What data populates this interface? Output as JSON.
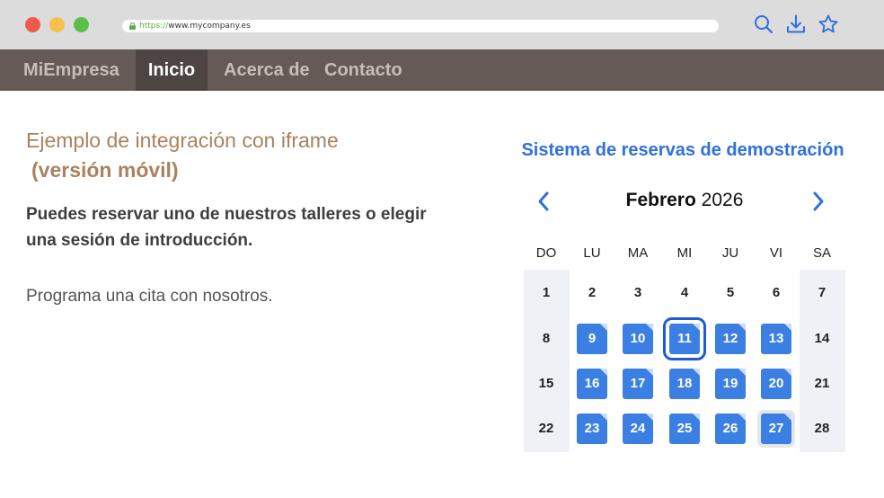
{
  "browser": {
    "url_protocol": "https://",
    "url_host": "www.mycompany.es",
    "icons": [
      "search-icon",
      "download-icon",
      "star-icon"
    ]
  },
  "nav": {
    "brand": "MiEmpresa",
    "items": [
      {
        "label": "Inicio",
        "active": true
      },
      {
        "label": "Acerca de",
        "active": false
      },
      {
        "label": "Contacto",
        "active": false
      }
    ]
  },
  "content": {
    "heading": "Ejemplo de integración con iframe",
    "heading_sub": "(versión móvil)",
    "lead": "Puedes reservar uno de nuestros talleres o elegir una sesión de introducción.",
    "body": "Programa una cita con nosotros."
  },
  "widget": {
    "title": "Sistema de reservas de demostración",
    "month": "Febrero",
    "year": "2026",
    "weekdays": [
      "DO",
      "LU",
      "MA",
      "MI",
      "JU",
      "VI",
      "SA"
    ],
    "weeks": [
      [
        "1",
        "2",
        "3",
        "4",
        "5",
        "6",
        "7"
      ],
      [
        "8",
        "9",
        "10",
        "11",
        "12",
        "13",
        "14"
      ],
      [
        "15",
        "16",
        "17",
        "18",
        "19",
        "20",
        "21"
      ],
      [
        "22",
        "23",
        "24",
        "25",
        "26",
        "27",
        "28"
      ]
    ],
    "available_days": [
      "9",
      "10",
      "11",
      "12",
      "13",
      "16",
      "17",
      "18",
      "19",
      "20",
      "23",
      "24",
      "25",
      "26",
      "27"
    ],
    "selected_day": "11",
    "today": "27",
    "colors": {
      "accent": "#3b7fe2",
      "title": "#2f6fde",
      "heading": "#a98260",
      "nav_bg": "#665a57"
    }
  }
}
